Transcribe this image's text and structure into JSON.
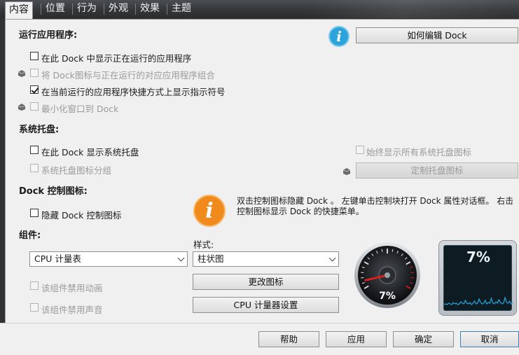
{
  "tabs": [
    {
      "label": "内容",
      "active": true
    },
    {
      "label": "位置",
      "active": false
    },
    {
      "label": "行为",
      "active": false
    },
    {
      "label": "外观",
      "active": false
    },
    {
      "label": "效果",
      "active": false
    },
    {
      "label": "主题",
      "active": false
    }
  ],
  "running_apps": {
    "heading": "运行应用程序:",
    "how_to_edit_button": "如何编辑 Dock",
    "options": [
      {
        "label": "在此 Dock 中显示正在运行的应用程序",
        "checked": false,
        "disabled": false
      },
      {
        "label": "将 Dock图标与正在运行的对应应用程序组合",
        "checked": false,
        "disabled": true
      },
      {
        "label": "在当前运行的应用程序快捷方式上显示指示符号",
        "checked": true,
        "disabled": false
      },
      {
        "label": "最小化窗口到 Dock",
        "checked": false,
        "disabled": true
      }
    ]
  },
  "system_tray": {
    "heading": "系统托盘:",
    "show_tray": {
      "label": "在此 Dock 显示系统托盘",
      "checked": false
    },
    "group_icons": {
      "label": "系统托盘图标分组",
      "checked": false,
      "disabled": true
    },
    "always_show_all": {
      "label": "始终显示所有系统托盘图标",
      "checked": false,
      "disabled": true
    },
    "customize_button": "定制托盘图标"
  },
  "dock_control": {
    "heading": "Dock 控制图标:",
    "hide": {
      "label": "隐藏 Dock 控制图标",
      "checked": false
    },
    "info_line1": "双击控制图标隐藏 Dock 。 左键单击控制块打开 Dock 属性对话框。 右击",
    "info_line2": "控制图标显示 Dock 的快捷菜单。"
  },
  "widgets": {
    "heading": "组件:",
    "selected_widget": "CPU 计量表",
    "style_label": "样式:",
    "selected_style": "柱状图",
    "disable_animation": {
      "label": "该组件禁用动画",
      "checked": false,
      "disabled": true
    },
    "disable_sound": {
      "label": "该组件禁用声音",
      "checked": false,
      "disabled": true
    },
    "change_icon_button": "更改图标",
    "cpu_settings_button": "CPU 计量器设置",
    "gauge_value_text": "7%",
    "monitor_value_text": "7%",
    "cpu_percent": 7
  },
  "footer": {
    "help": "帮助",
    "apply": "应用",
    "ok": "确定",
    "cancel": "取消"
  },
  "colors": {
    "info_blue": "#2ba4dc",
    "info_orange": "#f08a1c",
    "needle_red": "#d82020",
    "graph_cyan": "#23a7e0"
  }
}
